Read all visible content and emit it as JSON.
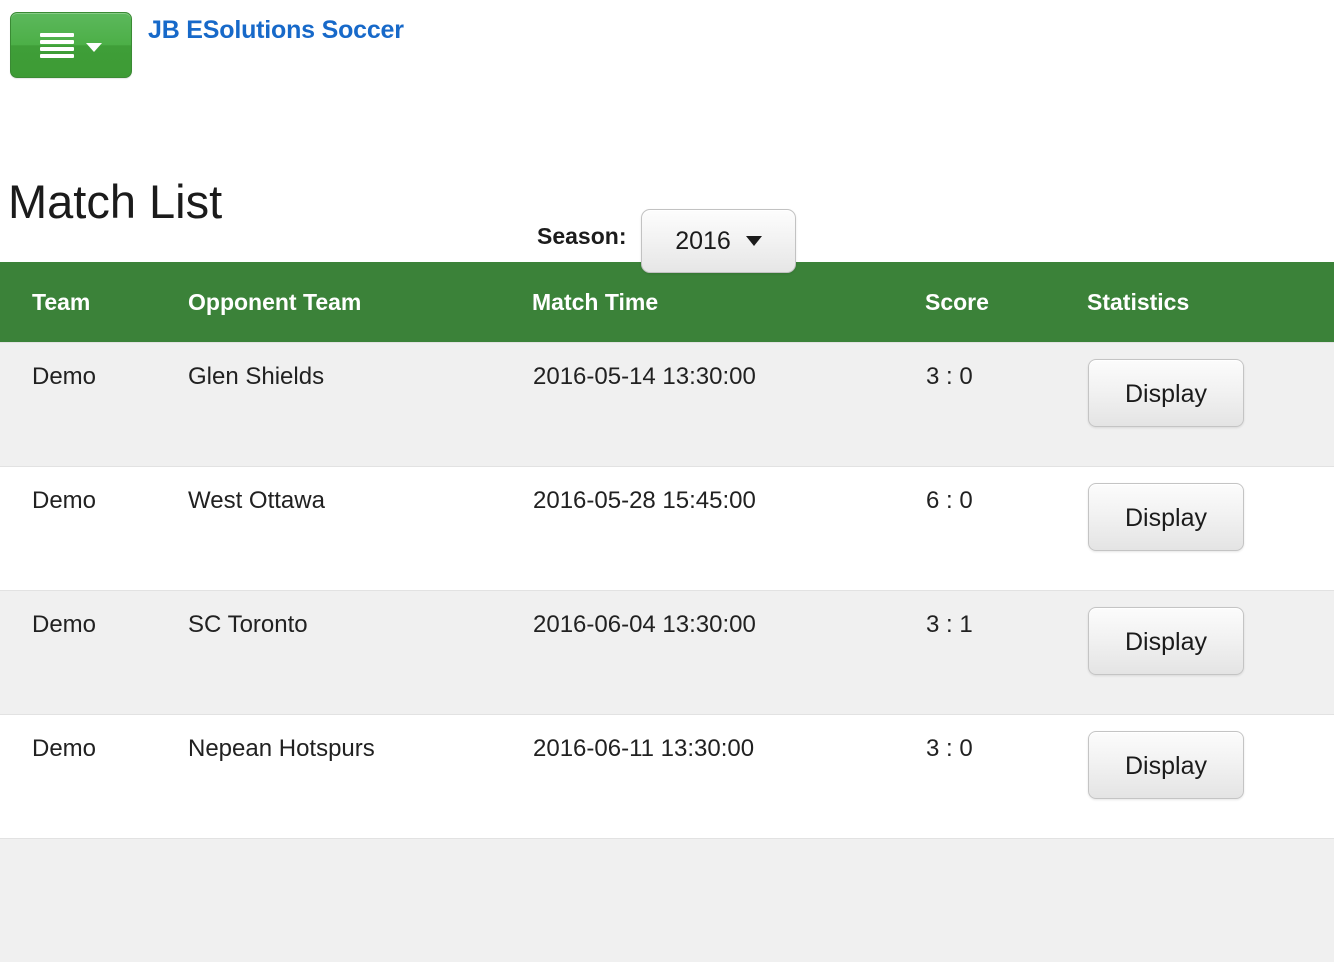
{
  "navbar": {
    "menu_icon": "hamburger-menu-icon",
    "menu_caret_icon": "chevron-down-icon",
    "brand": "JB ESolutions Soccer",
    "brand_color": "#1769c9",
    "menu_button_color": "#4caf47"
  },
  "season": {
    "label": "Season:",
    "selected": "2016",
    "caret_icon": "chevron-down-icon"
  },
  "page": {
    "title": "Match List",
    "header_color": "#3b8239"
  },
  "table": {
    "columns": [
      "Team",
      "Opponent Team",
      "Match Time",
      "Score",
      "Statistics"
    ],
    "rows": [
      {
        "team": "Demo",
        "opponent": "Glen Shields",
        "match_time": "2016-05-14 13:30:00",
        "score": "3 : 0",
        "action": "Display"
      },
      {
        "team": "Demo",
        "opponent": "West Ottawa",
        "match_time": "2016-05-28 15:45:00",
        "score": "6 : 0",
        "action": "Display"
      },
      {
        "team": "Demo",
        "opponent": "SC Toronto",
        "match_time": "2016-06-04 13:30:00",
        "score": "3 : 1",
        "action": "Display"
      },
      {
        "team": "Demo",
        "opponent": "Nepean Hotspurs",
        "match_time": "2016-06-11 13:30:00",
        "score": "3 : 0",
        "action": "Display"
      }
    ]
  }
}
